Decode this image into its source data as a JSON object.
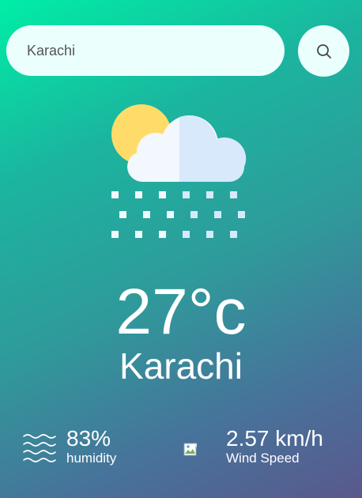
{
  "search": {
    "value": "Karachi",
    "icon": "search-icon"
  },
  "weather": {
    "icon": "cloud-sun-rain-icon",
    "temperature": "27°c",
    "city": "Karachi"
  },
  "details": {
    "humidity": {
      "value": "83%",
      "label": "humidity",
      "icon": "humidity-waves-icon"
    },
    "wind": {
      "value": "2.57 km/h",
      "label": "Wind Speed",
      "icon": "broken-image-icon"
    }
  },
  "colors": {
    "gradient_start": "#00eea6",
    "gradient_end": "#5a588d",
    "input_background": "#ebfffc",
    "text": "#ffffff"
  }
}
